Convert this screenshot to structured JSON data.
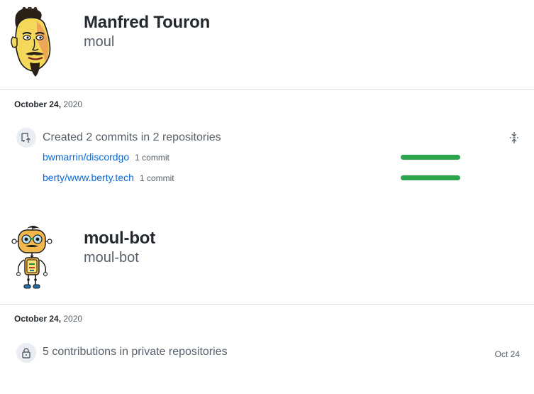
{
  "users": [
    {
      "fullname": "Manfred Touron",
      "username": "moul",
      "date_md": "October 24,",
      "date_year": "2020",
      "activity": "Created 2 commits in 2 repositories",
      "repos": [
        {
          "name": "bwmarrin/discordgo",
          "count": "1 commit",
          "share": 1.0
        },
        {
          "name": "berty/www.berty.tech",
          "count": "1 commit",
          "share": 1.0
        }
      ]
    },
    {
      "fullname": "moul-bot",
      "username": "moul-bot",
      "date_md": "October 24,",
      "date_year": "2020",
      "activity": "5 contributions in private repositories",
      "when": "Oct 24"
    }
  ],
  "colors": {
    "link": "#0969da",
    "bar": "#2da44e",
    "muted": "#57606a"
  }
}
